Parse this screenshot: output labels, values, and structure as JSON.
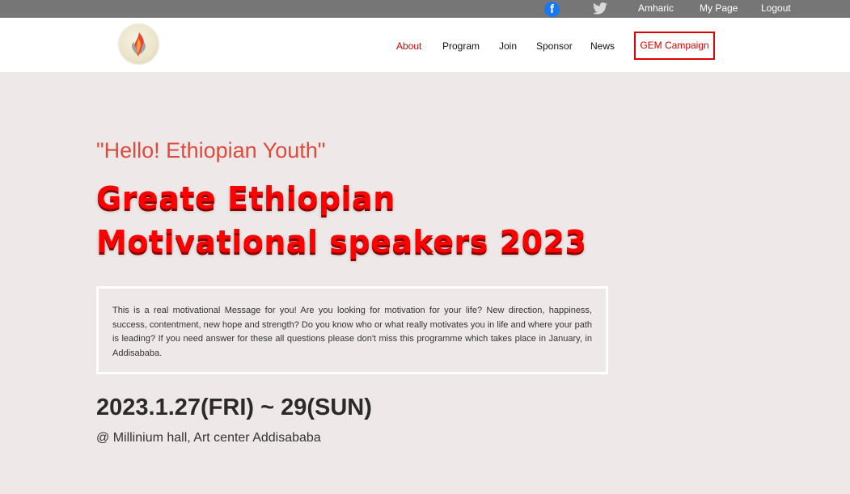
{
  "topbar": {
    "icons": [
      "facebook-icon",
      "twitter-icon"
    ],
    "facebook_glyph": "f",
    "links": [
      "Amharic",
      "My Page",
      "Logout"
    ]
  },
  "header": {
    "logo": "torch-logo",
    "nav": [
      "About",
      "Program",
      "Join",
      "Sponsor",
      "News"
    ],
    "active_nav": "About",
    "campaign_button": "GEM Campaign"
  },
  "hero": {
    "greeting": "\"Hello! Ethiopian Youth\"",
    "title_line1": "Greate Ethiopian",
    "title_line2": "Motivational speakers 2023",
    "message": "This is a real motivational Message for you! Are you looking for motivation for your life? New direction, happiness, success, contentment, new hope and strength? Do you know who or what really motivates you in life and where your path is leading? If you need answer for these all questions please don't miss this programme which takes place in January, in Addisababa.",
    "date": "2023.1.27(FRI) ~ 29(SUN)",
    "venue": "@ Millinium hall, Art center Addisababa"
  },
  "colors": {
    "topbar_bg": "#767676",
    "accent_red": "#ff0000",
    "greeting_color": "#e04a3c",
    "page_bg": "#eee9e8"
  }
}
